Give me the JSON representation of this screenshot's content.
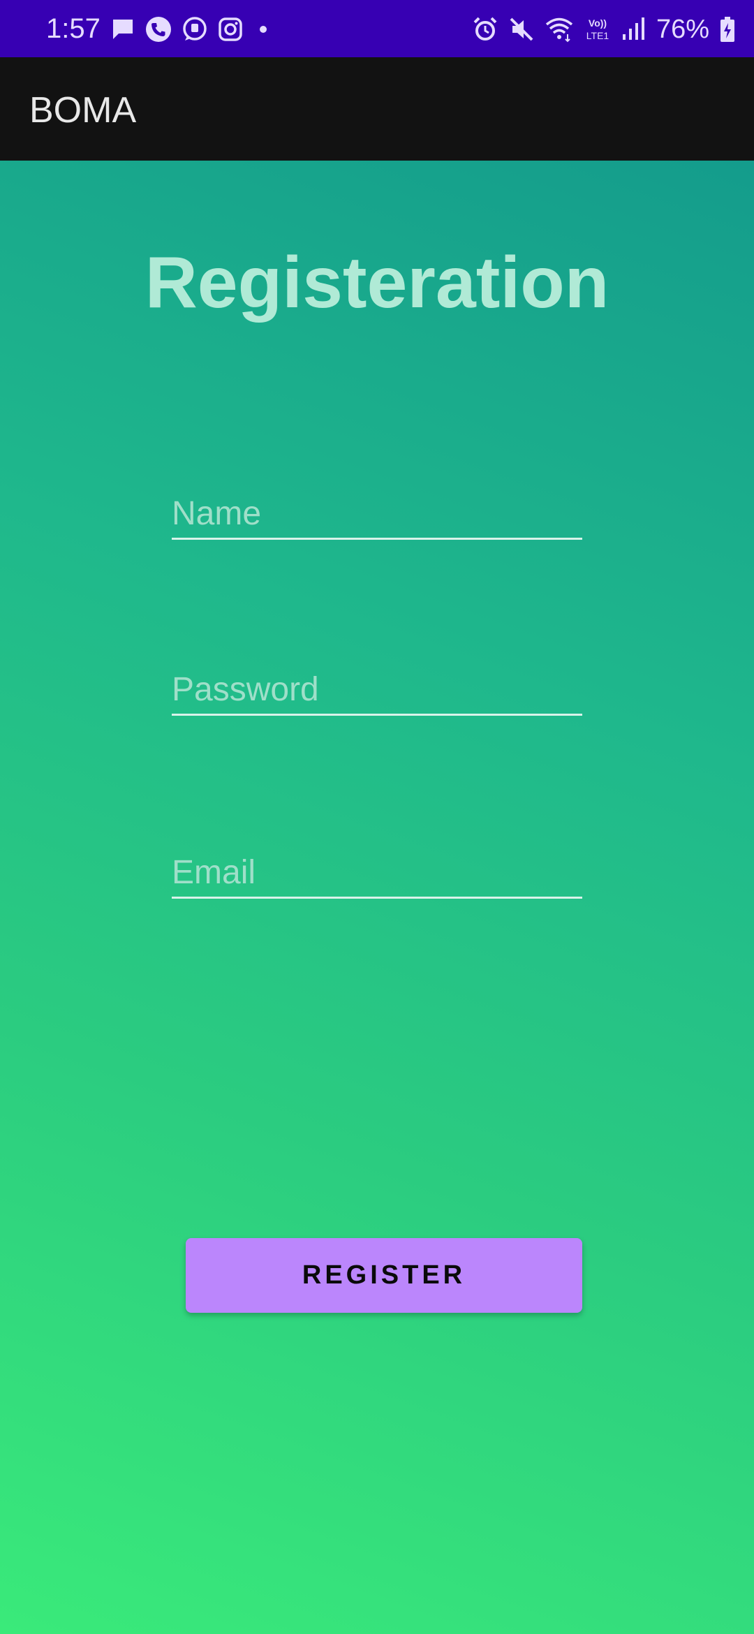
{
  "status_bar": {
    "time": "1:57",
    "battery_percent": "76%",
    "left_icons": [
      "message-icon",
      "phone-call-icon",
      "chat-icon",
      "instagram-icon",
      "dot-icon"
    ],
    "right_icons": [
      "alarm-icon",
      "mute-icon",
      "wifi-icon",
      "volte-icon",
      "signal-icon",
      "battery-charging-icon"
    ],
    "volte_label_top": "Vo))",
    "volte_label_bottom": "LTE1",
    "background_color": "#3700b3"
  },
  "app_bar": {
    "title": "BOMA",
    "background_color": "#121212"
  },
  "form": {
    "title": "Registeration",
    "name_placeholder": "Name",
    "name_value": "",
    "password_placeholder": "Password",
    "password_value": "",
    "email_placeholder": "Email",
    "email_value": "",
    "submit_label": "REGISTER",
    "submit_color": "#bb86fc"
  },
  "colors": {
    "gradient_top": "#149c8c",
    "gradient_bottom": "#3aea7a",
    "title_color": "#b0ead6"
  }
}
